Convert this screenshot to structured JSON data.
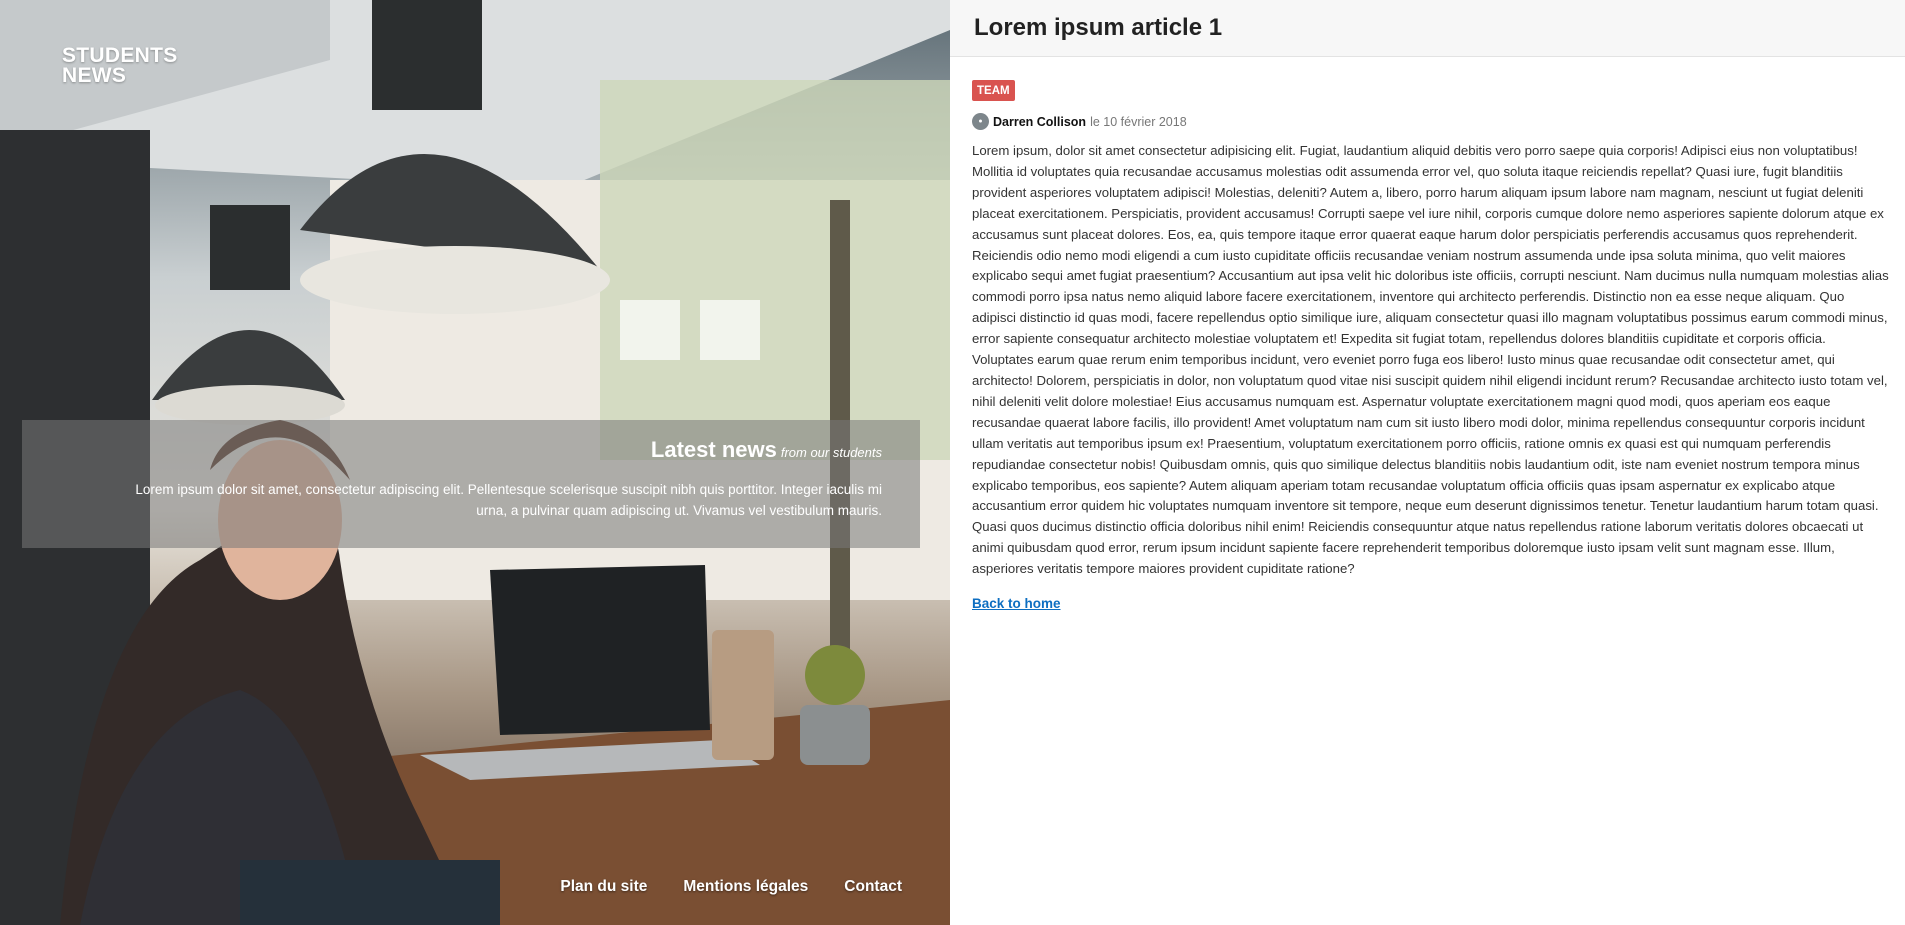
{
  "hero": {
    "brand_line1": "STUDENTS",
    "brand_line2": "NEWS",
    "news_title": "Latest news",
    "news_subtitle": "from our students",
    "news_description": "Lorem ipsum dolor sit amet, consectetur adipiscing elit. Pellentesque scelerisque suscipit nibh quis porttitor. Integer iaculis mi urna, a pulvinar quam adipiscing ut. Vivamus vel vestibulum mauris.",
    "footer_links": [
      "Plan du site",
      "Mentions légales",
      "Contact"
    ]
  },
  "article": {
    "title": "Lorem ipsum article 1",
    "tag": "TEAM",
    "author": "Darren Collison",
    "date": "le 10 février 2018",
    "body": "Lorem ipsum, dolor sit amet consectetur adipisicing elit. Fugiat, laudantium aliquid debitis vero porro saepe quia corporis! Adipisci eius non voluptatibus! Mollitia id voluptates quia recusandae accusamus molestias odit assumenda error vel, quo soluta itaque reiciendis repellat? Quasi iure, fugit blanditiis provident asperiores voluptatem adipisci! Molestias, deleniti? Autem a, libero, porro harum aliquam ipsum labore nam magnam, nesciunt ut fugiat deleniti placeat exercitationem. Perspiciatis, provident accusamus! Corrupti saepe vel iure nihil, corporis cumque dolore nemo asperiores sapiente dolorum atque ex accusamus sunt placeat dolores. Eos, ea, quis tempore itaque error quaerat eaque harum dolor perspiciatis perferendis accusamus quos reprehenderit. Reiciendis odio nemo modi eligendi a cum iusto cupiditate officiis recusandae veniam nostrum assumenda unde ipsa soluta minima, quo velit maiores explicabo sequi amet fugiat praesentium? Accusantium aut ipsa velit hic doloribus iste officiis, corrupti nesciunt. Nam ducimus nulla numquam molestias alias commodi porro ipsa natus nemo aliquid labore facere exercitationem, inventore qui architecto perferendis. Distinctio non ea esse neque aliquam. Quo adipisci distinctio id quas modi, facere repellendus optio similique iure, aliquam consectetur quasi illo magnam voluptatibus possimus earum commodi minus, error sapiente consequatur architecto molestiae voluptatem et! Expedita sit fugiat totam, repellendus dolores blanditiis cupiditate et corporis officia. Voluptates earum quae rerum enim temporibus incidunt, vero eveniet porro fuga eos libero! Iusto minus quae recusandae odit consectetur amet, qui architecto! Dolorem, perspiciatis in dolor, non voluptatum quod vitae nisi suscipit quidem nihil eligendi incidunt rerum? Recusandae architecto iusto totam vel, nihil deleniti velit dolore molestiae! Eius accusamus numquam est. Aspernatur voluptate exercitationem magni quod modi, quos aperiam eos eaque recusandae quaerat labore facilis, illo provident! Amet voluptatum nam cum sit iusto libero modi dolor, minima repellendus consequuntur corporis incidunt ullam veritatis aut temporibus ipsum ex! Praesentium, voluptatum exercitationem porro officiis, ratione omnis ex quasi est qui numquam perferendis repudiandae consectetur nobis! Quibusdam omnis, quis quo similique delectus blanditiis nobis laudantium odit, iste nam eveniet nostrum tempora minus explicabo temporibus, eos sapiente? Autem aliquam aperiam totam recusandae voluptatum officia officiis quas ipsam aspernatur ex explicabo atque accusantium error quidem hic voluptates numquam inventore sit tempore, neque eum deserunt dignissimos tenetur. Tenetur laudantium harum totam quasi. Quasi quos ducimus distinctio officia doloribus nihil enim! Reiciendis consequuntur atque natus repellendus ratione laborum veritatis dolores obcaecati ut animi quibusdam quod error, rerum ipsum incidunt sapiente facere reprehenderit temporibus doloremque iusto ipsam velit sunt magnam esse. Illum, asperiores veritatis tempore maiores provident cupiditate ratione?",
    "back_link": "Back to home"
  },
  "colors": {
    "tag_bg": "#d9534f",
    "link": "#0d6ec1"
  }
}
